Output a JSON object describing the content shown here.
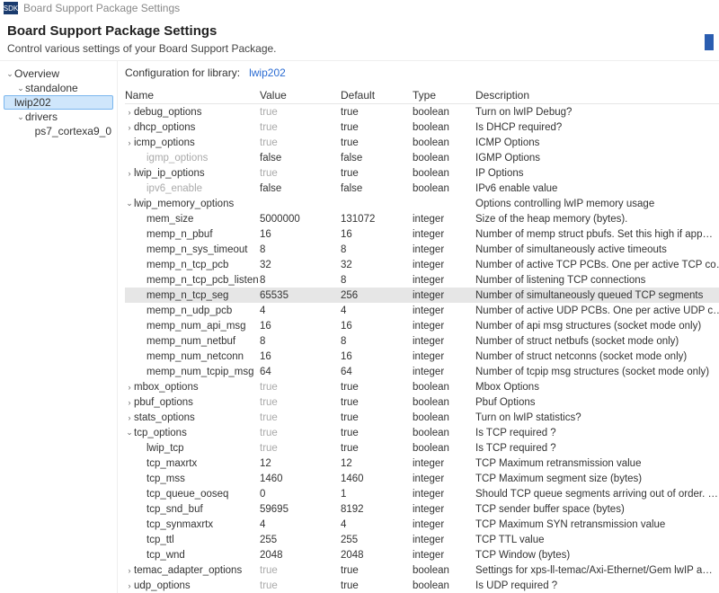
{
  "titlebar": {
    "app_badge": "SDK",
    "title": "Board Support Package Settings"
  },
  "header": {
    "title": "Board Support Package Settings",
    "subtitle": "Control various settings of your Board Support Package."
  },
  "sidebar": {
    "items": [
      {
        "label": "Overview",
        "depth": 0,
        "expand": "v",
        "selected": false
      },
      {
        "label": "standalone",
        "depth": 1,
        "expand": "v",
        "selected": false
      },
      {
        "label": "lwip202",
        "depth": 2,
        "expand": "",
        "selected": true
      },
      {
        "label": "drivers",
        "depth": 1,
        "expand": "v",
        "selected": false
      },
      {
        "label": "ps7_cortexa9_0",
        "depth": 2,
        "expand": "",
        "selected": false
      }
    ]
  },
  "content": {
    "config_label": "Configuration for library:",
    "lib_name": "lwip202",
    "columns": {
      "name": "Name",
      "value": "Value",
      "default": "Default",
      "type": "Type",
      "desc": "Description"
    },
    "rows": [
      {
        "indent": 0,
        "expand": ">",
        "name": "debug_options",
        "value": "true",
        "dim": true,
        "default": "true",
        "type": "boolean",
        "desc": "Turn on lwIP Debug?"
      },
      {
        "indent": 0,
        "expand": ">",
        "name": "dhcp_options",
        "value": "true",
        "dim": true,
        "default": "true",
        "type": "boolean",
        "desc": "Is DHCP required?"
      },
      {
        "indent": 0,
        "expand": ">",
        "name": "icmp_options",
        "value": "true",
        "dim": true,
        "default": "true",
        "type": "boolean",
        "desc": "ICMP Options"
      },
      {
        "indent": 1,
        "expand": "",
        "name": "igmp_options",
        "nameDim": true,
        "value": "false",
        "dim": false,
        "default": "false",
        "type": "boolean",
        "desc": "IGMP Options"
      },
      {
        "indent": 0,
        "expand": ">",
        "name": "lwip_ip_options",
        "value": "true",
        "dim": true,
        "default": "true",
        "type": "boolean",
        "desc": "IP Options"
      },
      {
        "indent": 1,
        "expand": "",
        "name": "ipv6_enable",
        "nameDim": true,
        "value": "false",
        "dim": false,
        "default": "false",
        "type": "boolean",
        "desc": "IPv6 enable value"
      },
      {
        "indent": 0,
        "expand": "v",
        "name": "lwip_memory_options",
        "value": "",
        "dim": false,
        "default": "",
        "type": "",
        "desc": "Options controlling lwIP memory usage"
      },
      {
        "indent": 1,
        "expand": "",
        "name": "mem_size",
        "value": "5000000",
        "dim": false,
        "default": "131072",
        "type": "integer",
        "desc": "Size of the heap memory (bytes)."
      },
      {
        "indent": 1,
        "expand": "",
        "name": "memp_n_pbuf",
        "value": "16",
        "dim": false,
        "default": "16",
        "type": "integer",
        "desc": "Number of memp struct pbufs. Set this high if app…"
      },
      {
        "indent": 1,
        "expand": "",
        "name": "memp_n_sys_timeout",
        "value": "8",
        "dim": false,
        "default": "8",
        "type": "integer",
        "desc": "Number of simultaneously active timeouts"
      },
      {
        "indent": 1,
        "expand": "",
        "name": "memp_n_tcp_pcb",
        "value": "32",
        "dim": false,
        "default": "32",
        "type": "integer",
        "desc": "Number of active TCP PCBs. One per active TCP co…"
      },
      {
        "indent": 1,
        "expand": "",
        "name": "memp_n_tcp_pcb_listen",
        "value": "8",
        "dim": false,
        "default": "8",
        "type": "integer",
        "desc": "Number of listening TCP connections"
      },
      {
        "indent": 1,
        "expand": "",
        "name": "memp_n_tcp_seg",
        "value": "65535",
        "dim": false,
        "default": "256",
        "type": "integer",
        "desc": "Number of simultaneously queued TCP segments",
        "selected": true
      },
      {
        "indent": 1,
        "expand": "",
        "name": "memp_n_udp_pcb",
        "value": "4",
        "dim": false,
        "default": "4",
        "type": "integer",
        "desc": "Number of active UDP PCBs. One per active UDP c…"
      },
      {
        "indent": 1,
        "expand": "",
        "name": "memp_num_api_msg",
        "value": "16",
        "dim": false,
        "default": "16",
        "type": "integer",
        "desc": "Number of api msg structures (socket mode only)"
      },
      {
        "indent": 1,
        "expand": "",
        "name": "memp_num_netbuf",
        "value": "8",
        "dim": false,
        "default": "8",
        "type": "integer",
        "desc": "Number of struct netbufs (socket mode only)"
      },
      {
        "indent": 1,
        "expand": "",
        "name": "memp_num_netconn",
        "value": "16",
        "dim": false,
        "default": "16",
        "type": "integer",
        "desc": "Number of struct netconns (socket mode only)"
      },
      {
        "indent": 1,
        "expand": "",
        "name": "memp_num_tcpip_msg",
        "value": "64",
        "dim": false,
        "default": "64",
        "type": "integer",
        "desc": "Number of tcpip msg structures (socket mode only)"
      },
      {
        "indent": 0,
        "expand": ">",
        "name": "mbox_options",
        "value": "true",
        "dim": true,
        "default": "true",
        "type": "boolean",
        "desc": "Mbox Options"
      },
      {
        "indent": 0,
        "expand": ">",
        "name": "pbuf_options",
        "value": "true",
        "dim": true,
        "default": "true",
        "type": "boolean",
        "desc": "Pbuf Options"
      },
      {
        "indent": 0,
        "expand": ">",
        "name": "stats_options",
        "value": "true",
        "dim": true,
        "default": "true",
        "type": "boolean",
        "desc": "Turn on lwIP statistics?"
      },
      {
        "indent": 0,
        "expand": "v",
        "name": "tcp_options",
        "value": "true",
        "dim": true,
        "default": "true",
        "type": "boolean",
        "desc": "Is TCP required ?"
      },
      {
        "indent": 1,
        "expand": "",
        "name": "lwip_tcp",
        "value": "true",
        "dim": true,
        "default": "true",
        "type": "boolean",
        "desc": "Is TCP required ?"
      },
      {
        "indent": 1,
        "expand": "",
        "name": "tcp_maxrtx",
        "value": "12",
        "dim": false,
        "default": "12",
        "type": "integer",
        "desc": "TCP Maximum retransmission value"
      },
      {
        "indent": 1,
        "expand": "",
        "name": "tcp_mss",
        "value": "1460",
        "dim": false,
        "default": "1460",
        "type": "integer",
        "desc": "TCP Maximum segment size (bytes)"
      },
      {
        "indent": 1,
        "expand": "",
        "name": "tcp_queue_ooseq",
        "value": "0",
        "dim": false,
        "default": "1",
        "type": "integer",
        "desc": "Should TCP queue segments arriving out of order. …"
      },
      {
        "indent": 1,
        "expand": "",
        "name": "tcp_snd_buf",
        "value": "59695",
        "dim": false,
        "default": "8192",
        "type": "integer",
        "desc": "TCP sender buffer space (bytes)"
      },
      {
        "indent": 1,
        "expand": "",
        "name": "tcp_synmaxrtx",
        "value": "4",
        "dim": false,
        "default": "4",
        "type": "integer",
        "desc": "TCP Maximum SYN retransmission value"
      },
      {
        "indent": 1,
        "expand": "",
        "name": "tcp_ttl",
        "value": "255",
        "dim": false,
        "default": "255",
        "type": "integer",
        "desc": "TCP TTL value"
      },
      {
        "indent": 1,
        "expand": "",
        "name": "tcp_wnd",
        "value": "2048",
        "dim": false,
        "default": "2048",
        "type": "integer",
        "desc": "TCP Window (bytes)"
      },
      {
        "indent": 0,
        "expand": ">",
        "name": "temac_adapter_options",
        "value": "true",
        "dim": true,
        "default": "true",
        "type": "boolean",
        "desc": "Settings for xps-ll-temac/Axi-Ethernet/Gem lwIP a…"
      },
      {
        "indent": 0,
        "expand": ">",
        "name": "udp_options",
        "value": "true",
        "dim": true,
        "default": "true",
        "type": "boolean",
        "desc": "Is UDP required ?"
      }
    ]
  }
}
